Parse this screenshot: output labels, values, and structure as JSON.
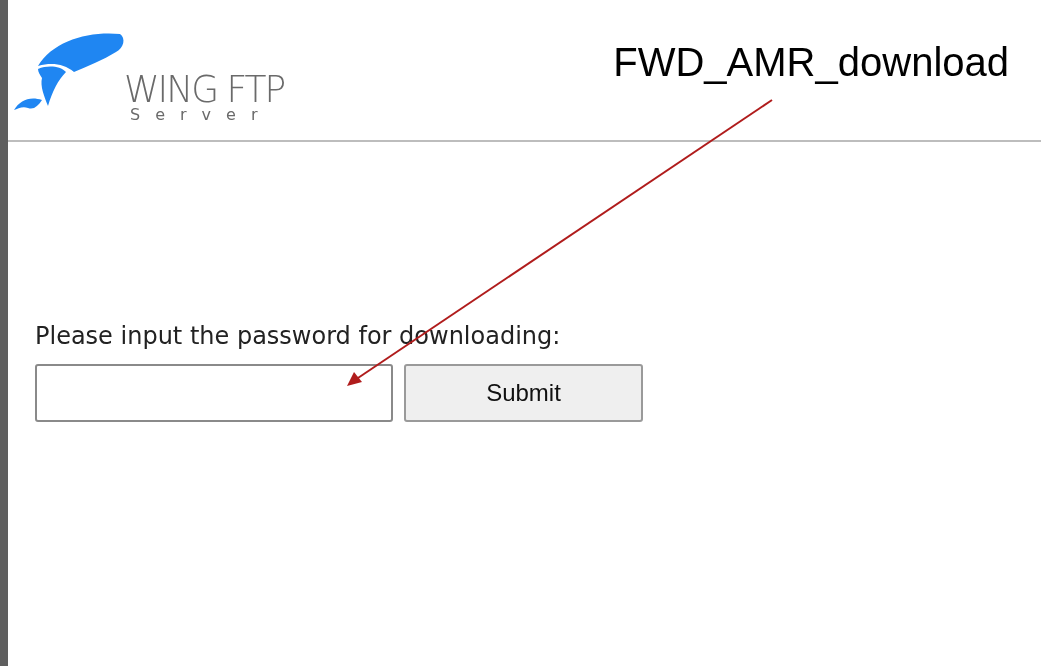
{
  "logo": {
    "name": "WING FTP",
    "subtitle": "Server"
  },
  "annotation": "FWD_AMR_download",
  "form": {
    "prompt": "Please input the password for downloading:",
    "button": "Submit"
  }
}
